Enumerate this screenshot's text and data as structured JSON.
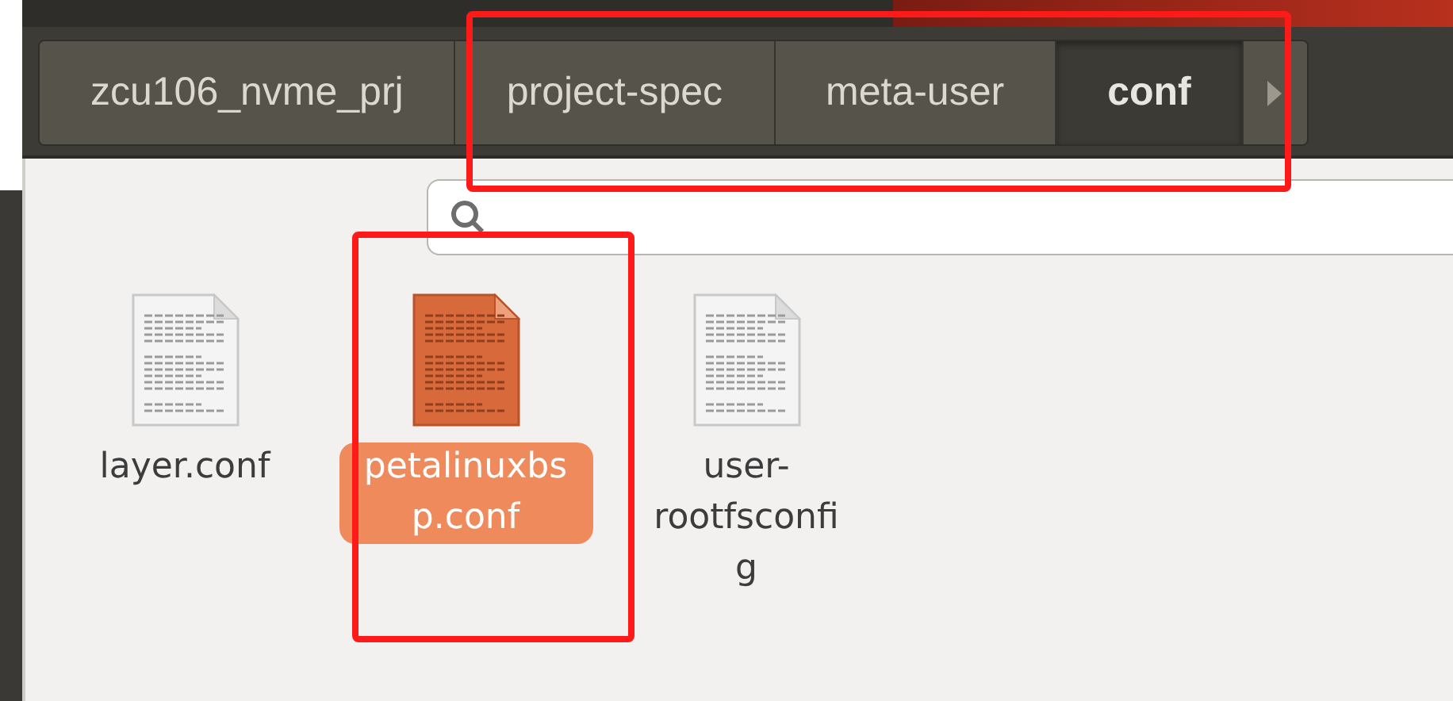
{
  "breadcrumbs": [
    {
      "label": "zcu106_nvme_prj",
      "selected": false
    },
    {
      "label": "project-spec",
      "selected": false
    },
    {
      "label": "meta-user",
      "selected": false
    },
    {
      "label": "conf",
      "selected": true
    }
  ],
  "files": [
    {
      "name": "layer.conf",
      "selected": false
    },
    {
      "name": "petalinuxbsp.conf",
      "selected": true
    },
    {
      "name": "user-rootfsconfig",
      "selected": false
    }
  ]
}
